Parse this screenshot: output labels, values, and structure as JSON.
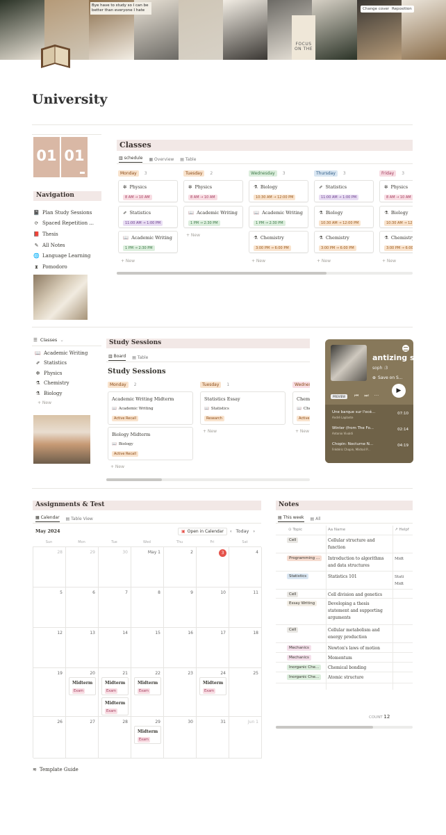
{
  "cover": {
    "quote": "Bye have to study so I can be better than everyone I hate",
    "focus_text": "FOCUS ON THE",
    "change_cover": "Change cover",
    "reposition": "Reposition",
    "colors": [
      "#2b3327",
      "#b59a78",
      "#8a6d4a",
      "#e9e2d6",
      "#cfc6b6",
      "#f2ede4",
      "#6c6a65",
      "#d7d1c6",
      "#3a3733",
      "#ece6dc"
    ]
  },
  "page_title": "University",
  "date_digits": [
    "01",
    "01"
  ],
  "navigation": {
    "title": "Navigation",
    "items": [
      {
        "icon": "📓",
        "label": "Plan Study Sessions"
      },
      {
        "icon": "⟳",
        "label": "Spaced Repetition ..."
      },
      {
        "icon": "📕",
        "label": "Thesis"
      },
      {
        "icon": "✎",
        "label": "All Notes"
      },
      {
        "icon": "🌐",
        "label": "Language Learning"
      },
      {
        "icon": "⧗",
        "label": "Pomodoro"
      }
    ]
  },
  "classes": {
    "title": "Classes",
    "tabs": [
      "schedule",
      "Overview",
      "Table"
    ],
    "new_label": "+ New",
    "columns": [
      {
        "day": "Monday",
        "count": "3",
        "color": "#f9e3cd",
        "text": "#8a4a16",
        "cards": [
          {
            "icon": "✼",
            "name": "Physics",
            "time": "8 AM → 10 AM",
            "tc": "tm-pink"
          },
          {
            "icon": "⇗",
            "name": "Statistics",
            "time": "11:00 AM → 1:00 PM",
            "tc": "tm-purp"
          },
          {
            "icon": "📖",
            "name": "Academic Writing",
            "time": "1 PM → 2:30 PM",
            "tc": "tm-green"
          }
        ]
      },
      {
        "day": "Tuesday",
        "count": "2",
        "color": "#f9e3cd",
        "text": "#8a4a16",
        "cards": [
          {
            "icon": "✼",
            "name": "Physics",
            "time": "8 AM → 10 AM",
            "tc": "tm-pink"
          },
          {
            "icon": "📖",
            "name": "Academic Writing",
            "time": "1 PM → 2:30 PM",
            "tc": "tm-green"
          }
        ]
      },
      {
        "day": "Wednesday",
        "count": "3",
        "color": "#dceedd",
        "text": "#3f7b4a",
        "cards": [
          {
            "icon": "⚗",
            "name": "Biology",
            "time": "10:30 AM → 12:00 PM",
            "tc": "tm-orange"
          },
          {
            "icon": "📖",
            "name": "Academic Writing",
            "time": "1 PM → 2:30 PM",
            "tc": "tm-green"
          },
          {
            "icon": "⚗",
            "name": "Chemistry",
            "time": "3:00 PM → 6:00 PM",
            "tc": "tm-orange"
          }
        ]
      },
      {
        "day": "Thursday",
        "count": "3",
        "color": "#d9e6f2",
        "text": "#2f5c85",
        "cards": [
          {
            "icon": "⇗",
            "name": "Statistics",
            "time": "11:00 AM → 1:00 PM",
            "tc": "tm-purp"
          },
          {
            "icon": "⚗",
            "name": "Biology",
            "time": "10:30 AM → 12:00 PM",
            "tc": "tm-orange"
          },
          {
            "icon": "⚗",
            "name": "Chemistry",
            "time": "3:00 PM → 6:00 PM",
            "tc": "tm-orange"
          }
        ]
      },
      {
        "day": "Friday",
        "count": "3",
        "color": "#f8dde3",
        "text": "#a33b5d",
        "cards": [
          {
            "icon": "✼",
            "name": "Physics",
            "time": "8 AM → 10 AM",
            "tc": "tm-pink"
          },
          {
            "icon": "⚗",
            "name": "Biology",
            "time": "10:30 AM → 12",
            "tc": "tm-orange"
          },
          {
            "icon": "⚗",
            "name": "Chemistry",
            "time": "3:00 PM → 6:00",
            "tc": "tm-orange"
          }
        ]
      }
    ]
  },
  "subjects": {
    "header": "Classes",
    "items": [
      {
        "icon": "📖",
        "label": "Academic Writing"
      },
      {
        "icon": "⇗",
        "label": "Statistics"
      },
      {
        "icon": "✼",
        "label": "Physics"
      },
      {
        "icon": "⚗",
        "label": "Chemistry"
      },
      {
        "icon": "⚗",
        "label": "Biology"
      }
    ],
    "new_label": "+ New"
  },
  "study": {
    "bar_title": "Study Sessions",
    "tabs": [
      "Board",
      "Table"
    ],
    "heading": "Study Sessions",
    "new_label": "+ New",
    "columns": [
      {
        "day": "Monday",
        "count": "2",
        "cards": [
          {
            "title": "Academic Writing Midterm",
            "prop": "Academic Writing",
            "tag": "Active Recall"
          },
          {
            "title": "Biology Midterm",
            "prop": "Biology",
            "tag": "Active Recall"
          }
        ]
      },
      {
        "day": "Tuesday",
        "count": "1",
        "cards": [
          {
            "title": "Statistics Essay",
            "prop": "Statistics",
            "tag": "Research"
          }
        ]
      },
      {
        "day": "Wednes",
        "count": "",
        "cards": [
          {
            "title": "Chemi",
            "prop": "Chem",
            "tag": "Active"
          }
        ]
      }
    ]
  },
  "music": {
    "title": "antizing s",
    "artist": "soph :3",
    "save": "Save on S...",
    "preview": "PREVIEW",
    "tracks": [
      {
        "name": "Une barque sur l'océ...",
        "artist": "André Laplante",
        "dur": "07:10"
      },
      {
        "name": "Winter (from The Fo...",
        "artist": "Antonio Vivaldi",
        "dur": "02:14"
      },
      {
        "name": "Chopin: Nocturne N...",
        "artist": "Frédéric Chopin, Mikhail P...",
        "dur": "04:19"
      }
    ]
  },
  "assignments": {
    "title": "Assignments & Test",
    "tabs": [
      "Calendar",
      "Table View"
    ],
    "month": "May 2024",
    "open_in_calendar": "Open in Calendar",
    "today": "Today",
    "weekdays": [
      "Sun",
      "Mon",
      "Tue",
      "Wed",
      "Thu",
      "Fri",
      "Sat"
    ],
    "weeks": [
      [
        "28",
        "29",
        "30",
        "May 1",
        "2",
        "3",
        "4"
      ],
      [
        "5",
        "6",
        "7",
        "8",
        "9",
        "10",
        "11"
      ],
      [
        "12",
        "13",
        "14",
        "15",
        "16",
        "17",
        "18"
      ],
      [
        "19",
        "20",
        "21",
        "22",
        "23",
        "24",
        "25"
      ],
      [
        "26",
        "27",
        "28",
        "29",
        "30",
        "31",
        "Jun 1"
      ]
    ],
    "today_color": "#e5534b",
    "events": [
      {
        "week": 3,
        "day": 1,
        "slot": 0,
        "title": "Midterm",
        "tag": "Exam"
      },
      {
        "week": 3,
        "day": 2,
        "slot": 0,
        "title": "Midterm",
        "tag": "Exam"
      },
      {
        "week": 3,
        "day": 2,
        "slot": 1,
        "title": "Midterm",
        "tag": "Exam"
      },
      {
        "week": 3,
        "day": 3,
        "slot": 0,
        "title": "Midterm",
        "tag": "Exam"
      },
      {
        "week": 3,
        "day": 5,
        "slot": 0,
        "title": "Midterm",
        "tag": "Exam"
      },
      {
        "week": 4,
        "day": 3,
        "slot": 0,
        "title": "Midterm",
        "tag": "Exam"
      }
    ]
  },
  "notes": {
    "title": "Notes",
    "tabs": [
      "This week",
      "All"
    ],
    "headers": [
      "Topic",
      "Name",
      "Helpf"
    ],
    "rows": [
      {
        "topic": "Cell",
        "color": "#e9e7e3",
        "name": "Cellular structure and function",
        "helpful": ""
      },
      {
        "topic": "Programming ...",
        "color": "#f6dcd0",
        "name": "Introduction to algorithms and data structures",
        "helpful": "Midt"
      },
      {
        "topic": "Statistics",
        "color": "#d9e6f2",
        "name": "Statistics 101",
        "helpful": "Stati Midt"
      },
      {
        "topic": "Cell",
        "color": "#e9e7e3",
        "name": "Cell division and genetics",
        "helpful": ""
      },
      {
        "topic": "Essay Writing",
        "color": "#f2ede4",
        "name": "Developing a thesis statement and supporting arguments",
        "helpful": ""
      },
      {
        "topic": "Cell",
        "color": "#e9e7e3",
        "name": "Cellular metabolism and energy production",
        "helpful": ""
      },
      {
        "topic": "Mechanics",
        "color": "#f4dfea",
        "name": "Newton's laws of motion",
        "helpful": ""
      },
      {
        "topic": "Mechanics",
        "color": "#f4dfea",
        "name": "Momentum",
        "helpful": ""
      },
      {
        "topic": "Inorganic Che...",
        "color": "#dceedd",
        "name": "Chemical bonding",
        "helpful": ""
      },
      {
        "topic": "Inorganic Che...",
        "color": "#dceedd",
        "name": "Atomic structure",
        "helpful": ""
      }
    ],
    "count_label": "COUNT",
    "count": "12"
  },
  "footer_link": "Template Guide"
}
